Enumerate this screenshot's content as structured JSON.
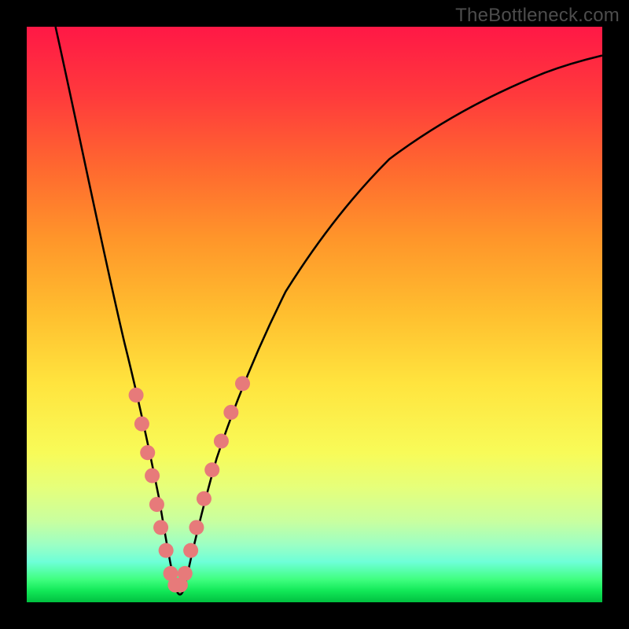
{
  "attribution": "TheBottleneck.com",
  "colors": {
    "frame": "#000000",
    "curve": "#000000",
    "marker": "#e77a7a",
    "gradient_top": "#ff1846",
    "gradient_bottom": "#00c040"
  },
  "chart_data": {
    "type": "line",
    "title": "",
    "xlabel": "",
    "ylabel": "",
    "xlim": [
      0,
      100
    ],
    "ylim": [
      0,
      100
    ],
    "comment": "V-shaped bottleneck curve on a red-yellow-green vertical gradient. y-axis reads as percentage mismatch / bottleneck; minimum (best) sits near x≈26.",
    "series": [
      {
        "name": "bottleneck-curve",
        "x": [
          5,
          8,
          11,
          14,
          17,
          19,
          21,
          23,
          24,
          25,
          26,
          27,
          28,
          29,
          31,
          33,
          36,
          40,
          45,
          50,
          56,
          63,
          71,
          80,
          90,
          100
        ],
        "y": [
          100,
          86,
          72,
          58,
          45,
          36,
          28,
          18,
          12,
          6,
          2,
          2,
          6,
          11,
          18,
          25,
          34,
          44,
          54,
          62,
          70,
          77,
          83,
          88,
          92,
          95
        ]
      }
    ],
    "markers": {
      "name": "highlighted-points",
      "comment": "Salmon dots clustered around the valley of the V on both branches, roughly y in [4,38].",
      "points": [
        {
          "x": 19.0,
          "y": 36
        },
        {
          "x": 20.0,
          "y": 31
        },
        {
          "x": 21.0,
          "y": 26
        },
        {
          "x": 21.8,
          "y": 22
        },
        {
          "x": 22.6,
          "y": 17
        },
        {
          "x": 23.3,
          "y": 13
        },
        {
          "x": 24.2,
          "y": 9
        },
        {
          "x": 25.0,
          "y": 5
        },
        {
          "x": 25.8,
          "y": 3
        },
        {
          "x": 26.7,
          "y": 3
        },
        {
          "x": 27.5,
          "y": 5
        },
        {
          "x": 28.5,
          "y": 9
        },
        {
          "x": 29.5,
          "y": 13
        },
        {
          "x": 30.8,
          "y": 18
        },
        {
          "x": 32.2,
          "y": 23
        },
        {
          "x": 33.8,
          "y": 28
        },
        {
          "x": 35.5,
          "y": 33
        },
        {
          "x": 37.5,
          "y": 38
        }
      ]
    }
  }
}
